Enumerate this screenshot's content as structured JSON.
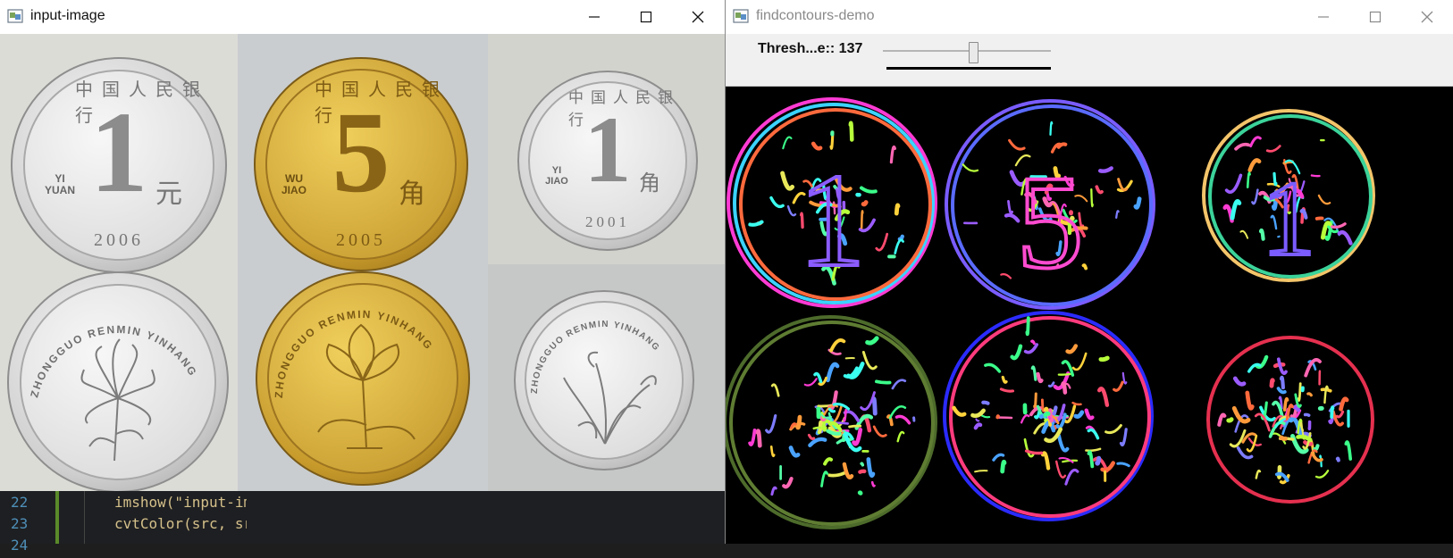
{
  "left_window": {
    "title": "input-image",
    "icon": "opencv-window-icon",
    "coins": [
      {
        "face": "value",
        "value": "1",
        "latin_lines": [
          "YI",
          "YUAN"
        ],
        "chinese_unit": "元",
        "year": "2006",
        "material": "silver"
      },
      {
        "face": "value",
        "value": "5",
        "latin_lines": [
          "WU",
          "JIAO"
        ],
        "chinese_unit": "角",
        "year": "2005",
        "material": "gold"
      },
      {
        "face": "value",
        "value": "1",
        "latin_lines": [
          "YI",
          "JIAO"
        ],
        "chinese_unit": "角",
        "year": "2001",
        "material": "silver"
      },
      {
        "face": "flower",
        "flower": "chrysanthemum",
        "rim_text": "ZHONGGUO RENMIN YINHANG",
        "material": "silver"
      },
      {
        "face": "flower",
        "flower": "lotus",
        "rim_text": "ZHONGGUO RENMIN YINHANG",
        "material": "gold"
      },
      {
        "face": "flower",
        "flower": "orchid",
        "rim_text": "ZHONGGUO RENMIN YINHANG",
        "material": "silver"
      }
    ],
    "top_rim_text": "中国人民银行"
  },
  "code_editor": {
    "lines": [
      {
        "number": "22",
        "code": "imshow(\"input-im"
      },
      {
        "number": "23",
        "code": "cvtColor(src, sr"
      },
      {
        "number": "24",
        "code": ""
      }
    ]
  },
  "right_window": {
    "title": "findcontours-demo",
    "icon": "opencv-window-icon",
    "trackbar": {
      "label": "Thresh...e:: 137",
      "value": 137,
      "max": 255
    },
    "colors": {
      "black": "#000000"
    }
  },
  "window_controls": {
    "minimize": "minimize-icon",
    "maximize": "maximize-icon",
    "close": "close-icon"
  }
}
